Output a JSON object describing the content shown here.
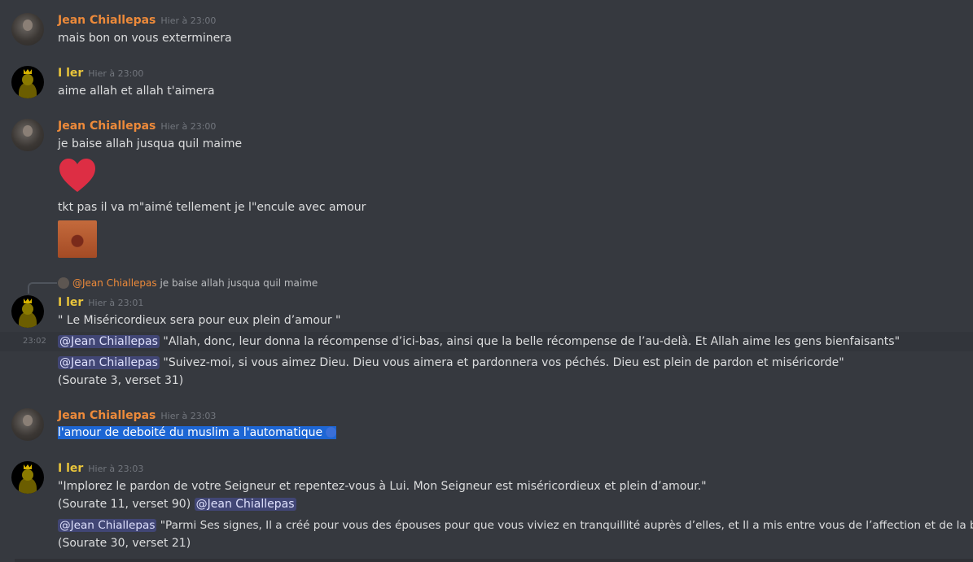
{
  "messages": [
    {
      "author": "Jean Chiallepas",
      "timestamp": "Hier à 23:00",
      "lines": [
        "mais bon on vous exterminera"
      ]
    },
    {
      "author": "I ler",
      "timestamp": "Hier à 23:00",
      "lines": [
        "aime allah et allah t'aimera"
      ]
    },
    {
      "author": "Jean Chiallepas",
      "timestamp": "Hier à 23:00",
      "lines": [
        "je baise allah jusqua quil maime",
        "tkt pas il va m\"aimé tellement je l\"encule avec amour"
      ],
      "emoji": "heart"
    },
    {
      "reply": {
        "mention": "@Jean Chiallepas",
        "text": "je baise allah jusqua quil maime"
      },
      "author": "I ler",
      "timestamp": "Hier à 23:01",
      "side_timestamp": "23:02",
      "lines": [
        "\" Le Miséricordieux sera pour eux plein d’amour \"",
        "\"Allah, donc, leur donna la récompense d’ici-bas, ainsi que la belle récompense de l’au-delà. Et Allah aime les gens bienfaisants\"",
        "\"Suivez-moi, si vous aimez Dieu. Dieu vous aimera et pardonnera vos péchés. Dieu est plein de pardon et miséricorde\"",
        "(Sourate 3, verset 31)"
      ],
      "mention": "@Jean Chiallepas"
    },
    {
      "author": "Jean Chiallepas",
      "timestamp": "Hier à 23:03",
      "lines": [
        "l'amour de deboité du muslim a l'automatique"
      ]
    },
    {
      "author": "I ler",
      "timestamp": "Hier à 23:03",
      "lines": [
        "\"Implorez le pardon de votre Seigneur et repentez-vous à Lui. Mon Seigneur est miséricordieux et plein d’amour.\"",
        "(Sourate 11, verset 90)",
        "\"Parmi Ses signes, Il a créé pour vous des épouses pour que vous viviez en tranquillité auprès d’elles, et Il a mis entre vous de l’affection et de la bonté.\"",
        "(Sourate 30, verset 21)"
      ],
      "mention": "@Jean Chiallepas"
    }
  ],
  "colors": {
    "background": "#36393f",
    "jean_name": "#ed8a3a",
    "iler_name": "#e9c53b",
    "mention_bg": "#414675",
    "selection": "#1d66d4",
    "heart": "#dd2e44"
  }
}
